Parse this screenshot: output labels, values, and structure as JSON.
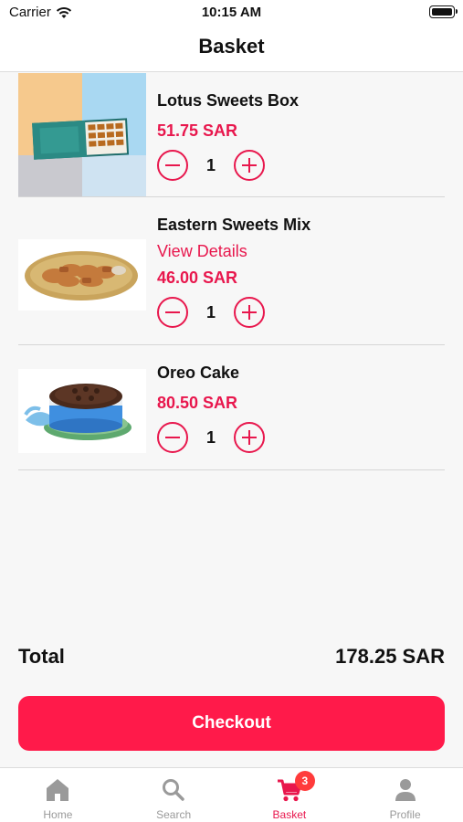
{
  "status_bar": {
    "carrier": "Carrier",
    "time": "10:15 AM"
  },
  "nav": {
    "title": "Basket"
  },
  "items": [
    {
      "name": "Lotus Sweets Box",
      "link": "",
      "price": "51.75 SAR",
      "qty": "1"
    },
    {
      "name": "Eastern Sweets Mix",
      "link": "View Details",
      "price": "46.00 SAR",
      "qty": "1"
    },
    {
      "name": "Oreo Cake",
      "link": "",
      "price": "80.50 SAR",
      "qty": "1"
    }
  ],
  "summary": {
    "total_label": "Total",
    "total_value": "178.25 SAR"
  },
  "checkout": {
    "label": "Checkout"
  },
  "tabs": [
    {
      "label": "Home",
      "icon": "home-icon"
    },
    {
      "label": "Search",
      "icon": "search-icon"
    },
    {
      "label": "Basket",
      "icon": "cart-icon",
      "badge": "3"
    },
    {
      "label": "Profile",
      "icon": "person-icon"
    }
  ],
  "colors": {
    "accent": "#e8174d",
    "checkout_bg": "#ff1a4a",
    "badge": "#ff3b3b",
    "inactive_tab": "#9a9a9a"
  }
}
